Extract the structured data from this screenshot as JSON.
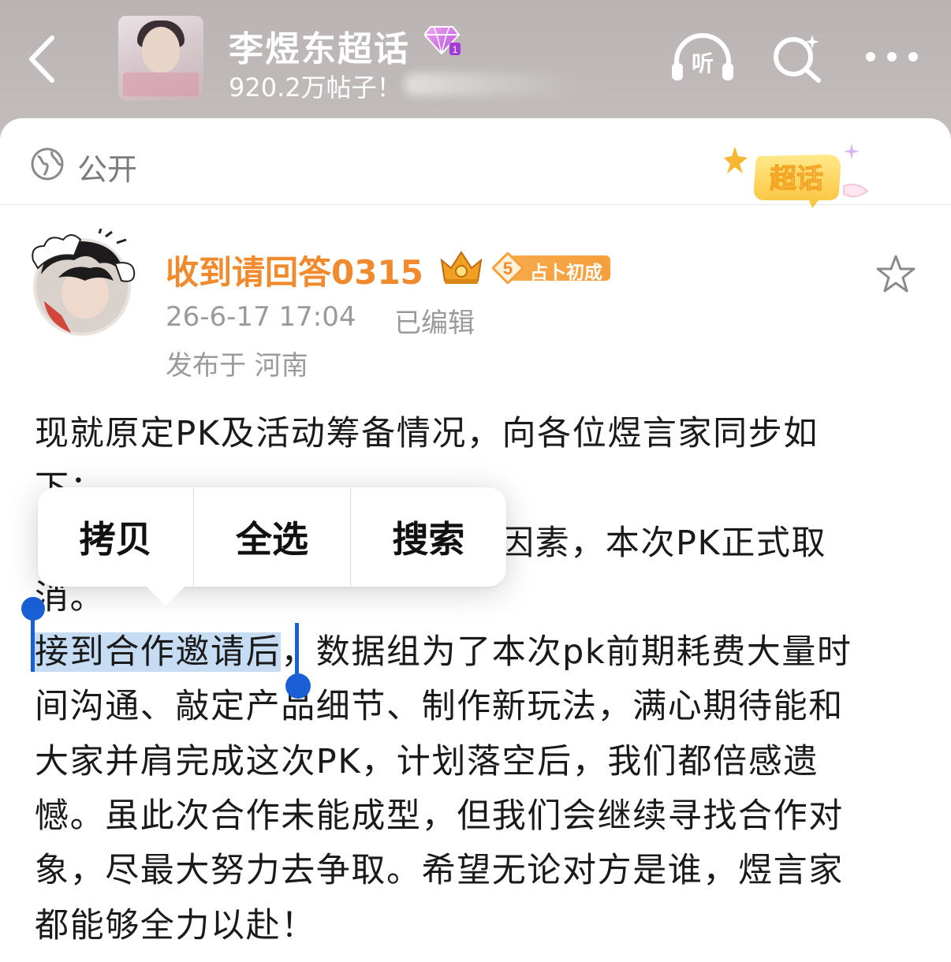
{
  "header": {
    "back_icon": "chevron-left-icon",
    "title": "李煜东超话",
    "level_icon": "gem-icon",
    "subtitle": "920.2万帖子！",
    "listen_label": "听",
    "search_icon": "search-icon",
    "more_icon": "more-icon"
  },
  "visibility": {
    "icon": "globe-icon",
    "label": "公开",
    "badge_label": "超话"
  },
  "post": {
    "username": "收到请回答0315",
    "rank_level": "5",
    "rank_title": "占卜初成",
    "date": "26-6-17 17:04",
    "edited": "已编辑",
    "location": "发布于 河南",
    "lines": [
      "现就原定PK及活动筹备情况，向各位煜言家同步如",
      "下：",
      "因素，本次PK正式取",
      "消。",
      "接到合作邀请后",
      "，数据组为了本次pk前期耗费大量时",
      "间沟通、敲定产品细节、制作新玩法，满心期待能和",
      "大家并肩完成这次PK，计划落空后，我们都倍感遗",
      "憾。虽此次合作未能成型，但我们会继续寻找合作对",
      "象，尽最大努力去争取。希望无论对方是谁，煜言家",
      "都能够全力以赴！"
    ]
  },
  "context_menu": {
    "copy": "拷贝",
    "select_all": "全选",
    "search": "搜索"
  },
  "colors": {
    "username": "#f08a2c",
    "selection": "#c6dcf3",
    "handle": "#1a5fd6"
  }
}
